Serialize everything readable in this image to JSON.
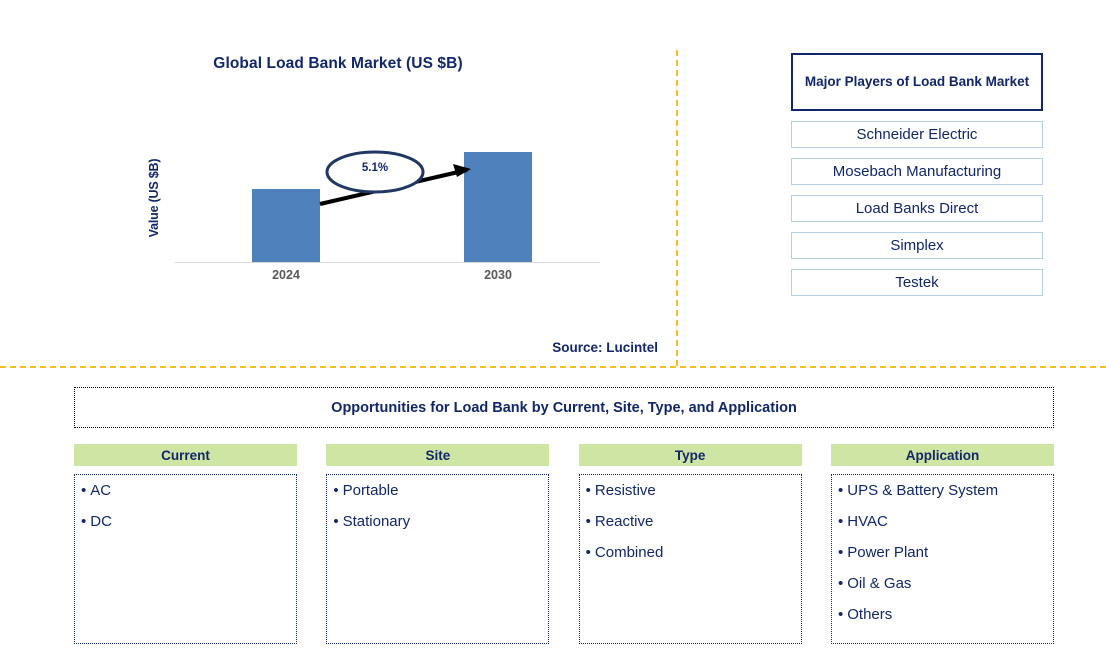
{
  "chart_panel": {
    "title": "Global Load Bank Market (US $B)",
    "y_axis_label": "Value (US $B)",
    "cagr_label": "5.1%",
    "source": "Source: Lucintel"
  },
  "chart_data": {
    "type": "bar",
    "title": "Global Load Bank Market (US $B)",
    "categories": [
      "2024",
      "2030"
    ],
    "values": [
      58,
      87
    ],
    "xlabel": "",
    "ylabel": "Value (US $B)",
    "grid": false,
    "legend": "none",
    "annotations": [
      {
        "text": "5.1%",
        "kind": "cagr-arrow",
        "from": "2024",
        "to": "2030"
      }
    ],
    "tick_labels": [
      "2024",
      "2030"
    ]
  },
  "players": {
    "title": "Major Players of Load Bank Market",
    "items": [
      "Schneider Electric",
      "Mosebach Manufacturing",
      "Load Banks Direct",
      "Simplex",
      "Testek"
    ]
  },
  "opportunities": {
    "header": "Opportunities for Load Bank by Current, Site, Type, and Application",
    "columns": [
      {
        "header": "Current",
        "items": [
          "AC",
          "DC"
        ]
      },
      {
        "header": "Site",
        "items": [
          "Portable",
          "Stationary"
        ]
      },
      {
        "header": "Type",
        "items": [
          "Resistive",
          "Reactive",
          "Combined"
        ]
      },
      {
        "header": "Application",
        "items": [
          "UPS & Battery System",
          "HVAC",
          "Power Plant",
          "Oil & Gas",
          "Others"
        ]
      }
    ]
  },
  "colors": {
    "bar": "#4f81bd",
    "navy": "#12266b",
    "green_header": "#cfe5a3",
    "divider": "#f5bd1f",
    "player_border": "#b7cfe8",
    "tick_text": "#595959"
  }
}
